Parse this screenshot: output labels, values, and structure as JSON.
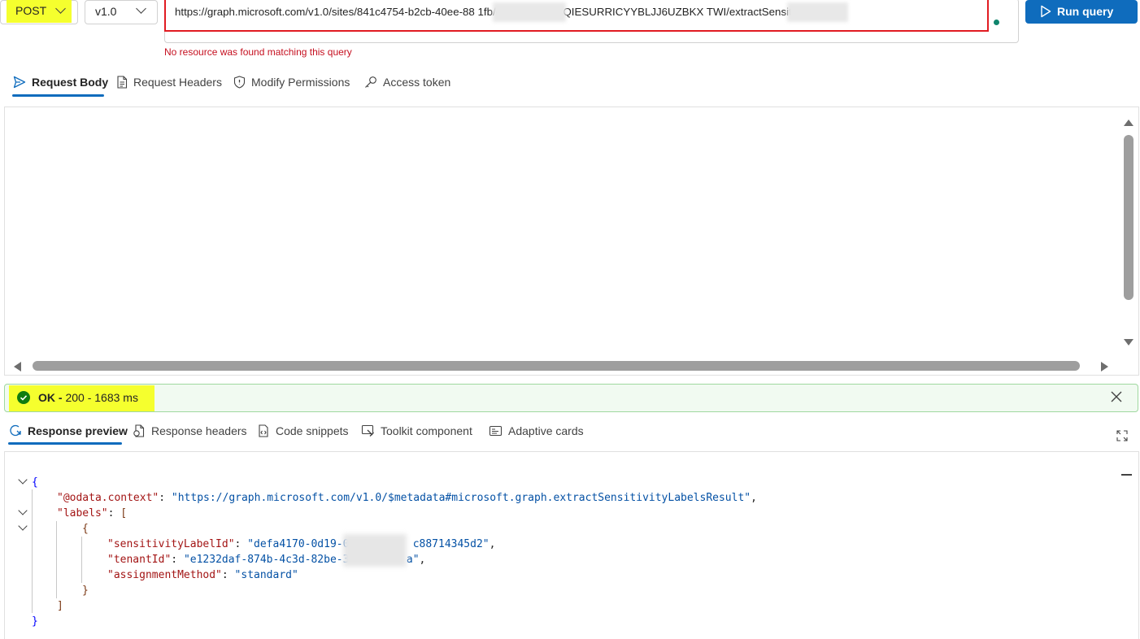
{
  "query": {
    "method": "POST",
    "version": "v1.0",
    "url": "https://graph.microsoft.com/v1.0/sites/841c4754-b2cb-40ee-88              1fb/drive/items/01QIESURRICYYBLJJ6UZBKX              TWI/extractSensitivityLabels",
    "error_message": "No resource was found matching this query",
    "run_label": "Run query"
  },
  "request_tabs": [
    {
      "label": "Request Body",
      "icon": "send-icon"
    },
    {
      "label": "Request Headers",
      "icon": "document-icon"
    },
    {
      "label": "Modify Permissions",
      "icon": "shield-icon"
    },
    {
      "label": "Access token",
      "icon": "key-icon"
    }
  ],
  "status": {
    "ok": "OK -",
    "detail": " 200 - 1683 ms",
    "color": "#107c10"
  },
  "response_tabs": [
    {
      "label": "Response preview",
      "icon": "preview-icon"
    },
    {
      "label": "Response headers",
      "icon": "document-icon"
    },
    {
      "label": "Code snippets",
      "icon": "code-icon"
    },
    {
      "label": "Toolkit component",
      "icon": "toolkit-icon"
    },
    {
      "label": "Adaptive cards",
      "icon": "card-icon"
    }
  ],
  "response": {
    "context_key": "\"@odata.context\"",
    "context_value": "\"https://graph.microsoft.com/v1.0/$metadata#microsoft.graph.extractSensitivityLabelsResult\"",
    "labels_key": "\"labels\"",
    "label_key": "\"sensitivityLabelId\"",
    "label_value": "\"defa4170-0d19-0          c88714345d2\"",
    "tenant_key": "\"tenantId\"",
    "tenant_value": "\"e1232daf-874b-4c3d-82be-3         a\"",
    "method_key": "\"assignmentMethod\"",
    "method_value": "\"standard\""
  },
  "colors": {
    "accent": "#0f6cbd",
    "highlight": "#f5ff2e",
    "error": "#c50f1f",
    "success_bg": "#f1faf1"
  }
}
